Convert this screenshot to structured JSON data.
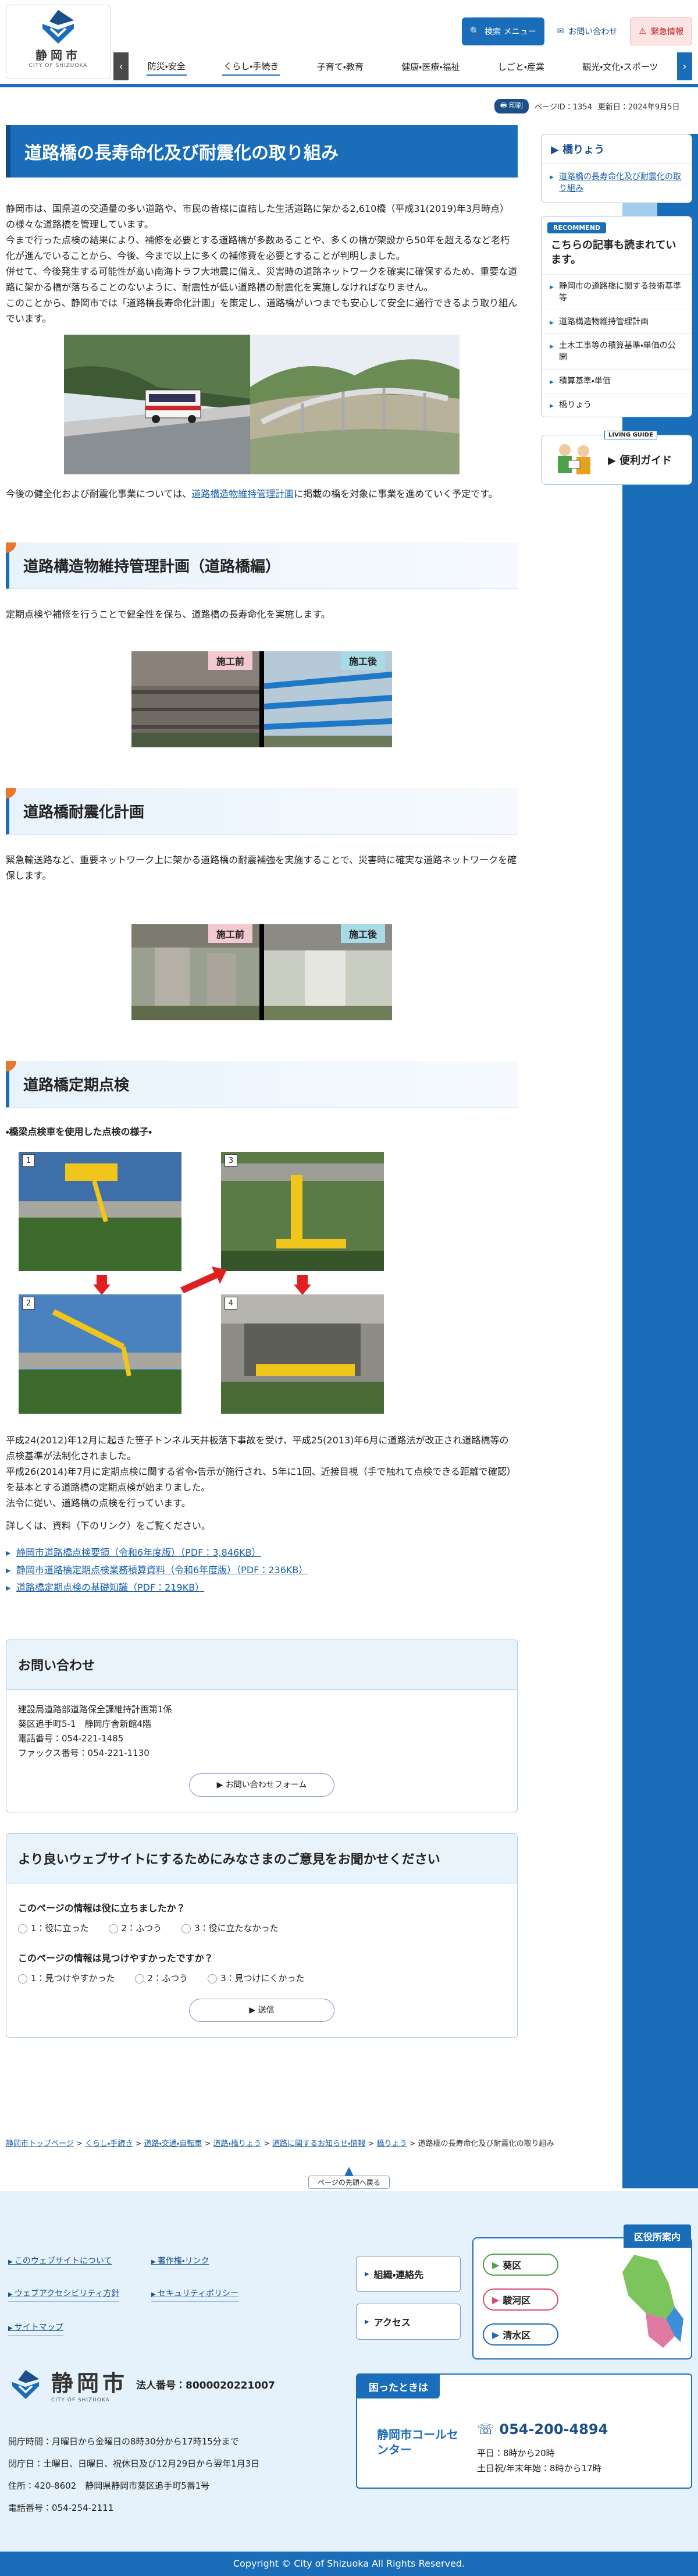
{
  "header": {
    "logo_name": "静岡市",
    "logo_sub": "CITY OF SHIZUOKA",
    "tools": {
      "search": "検索 メニュー",
      "contact": "お問い合わせ",
      "emergency": "緊急情報"
    },
    "nav": [
      "防災・安全",
      "くらし・手続き",
      "子育て・教育",
      "健康・医療・福祉",
      "しごと・産業",
      "観光・文化・スポーツ"
    ]
  },
  "page_info": {
    "print": "印刷",
    "page_id": "ページID：1354",
    "updated": "更新日：2024年9月5日"
  },
  "main": {
    "title": "道路橋の長寿命化及び耐震化の取り組み",
    "intro": [
      "静岡市は、国県道の交通量の多い道路や、市民の皆様に直結した生活道路に架かる2,610橋（平成31(2019)年3月時点）の様々な道路橋を管理しています。",
      "今まで行った点検の結果により、補修を必要とする道路橋が多数あることや、多くの橋が架設から50年を超えるなど老朽化が進んでいることから、今後、今まで以上に多くの補修費を必要とすることが判明しました。",
      "併せて、今後発生する可能性が高い南海トラフ大地震に備え、災害時の道路ネットワークを確実に確保するため、重要な道路に架かる橋が落ちることのないように、耐震性が低い道路橋の耐震化を実施しなければなりません。",
      "このことから、静岡市では「道路橋長寿命化計画」を策定し、道路橋がいつまでも安心して安全に通行できるよう取り組んでいます。"
    ],
    "plan_prefix": "今後の健全化および耐震化事業については、",
    "plan_link": "道路構造物維持管理計画",
    "plan_suffix": "に掲載の橋を対象に事業を進めていく予定です。",
    "section1": {
      "title": "道路構造物維持管理計画（道路橋編）",
      "text": "定期点検や補修を行うことで健全性を保ち、道路橋の長寿命化を実施します。",
      "before": "施工前",
      "after": "施工後"
    },
    "section2": {
      "title": "道路橋耐震化計画",
      "text": "緊急輸送路など、重要ネットワーク上に架かる道路橋の耐震補強を実施することで、災害時に確実な道路ネットワークを確保します。",
      "before": "施工前",
      "after": "施工後"
    },
    "section3": {
      "title": "道路橋定期点検",
      "step_label": "・橋梁点検車を使用した点検の様子・",
      "steps": [
        "1",
        "2",
        "3",
        "4"
      ],
      "texts": [
        "平成24(2012)年12月に起きた笹子トンネル天井板落下事故を受け、平成25(2013)年6月に道路法が改正され道路橋等の点検基準が法制化されました。",
        "平成26(2014)年7月に定期点検に関する省令・告示が施行され、5年に1回、近接目視（手で触れて点検できる距離で確認）を基本とする道路橋の定期点検が始まりました。",
        "法令に従い、道路橋の点検を行っています。"
      ],
      "see_more": "詳しくは、資料（下のリンク）をご覧ください。",
      "links": [
        "静岡市道路橋点検要領（令和6年度版）（PDF：3,846KB）",
        "静岡市道路橋定期点検業務積算資料（令和6年度版）（PDF：236KB）",
        "道路橋定期点検の基礎知識（PDF：219KB）"
      ]
    },
    "contact": {
      "title": "お問い合わせ",
      "lines": [
        "建設局道路部道路保全課維持計画第1係",
        "葵区追手町5-1　静岡庁舎新館4階",
        "電話番号：054-221-1485",
        "ファックス番号：054-221-1130"
      ],
      "button": "お問い合わせフォーム"
    },
    "survey": {
      "title": "より良いウェブサイトにするためにみなさまのご意見をお聞かせください",
      "q1": "このページの情報は役に立ちましたか？",
      "q1_opts": [
        "1：役に立った",
        "2：ふつう",
        "3：役に立たなかった"
      ],
      "q2": "このページの情報は見つけやすかったですか？",
      "q2_opts": [
        "1：見つけやすかった",
        "2：ふつう",
        "3：見つけにくかった"
      ],
      "submit": "送信"
    }
  },
  "breadcrumb": [
    "静岡市トップページ",
    "くらし・手続き",
    "道路・交通・自転車",
    "道路・橋りょう",
    "道路に関するお知らせ・情報",
    "橋りょう",
    "道路橋の長寿命化及び耐震化の取り組み"
  ],
  "sidebar": {
    "category": "橋りょう",
    "current": "道路橋の長寿命化及び耐震化の取り組み",
    "reco_badge": "RECOMMEND",
    "reco_title": "こちらの記事も読まれています。",
    "reco_items": [
      "静岡市の道路橋に関する技術基準等",
      "道路構造物維持管理計画",
      "土木工事等の積算基準・単価の公開",
      "積算基準・単価",
      "橋りょう"
    ],
    "living_label": "LIVING GUIDE",
    "living_text": "便利ガイド"
  },
  "totop": "ページの先頭へ戻る",
  "footer": {
    "links": [
      "このウェブサイトについて",
      "著作権・リンク",
      "ウェブアクセシビリティ方針",
      "セキュリティポリシー",
      "サイトマップ"
    ],
    "btn_org": "組織・連絡先",
    "btn_access": "アクセス",
    "ward_title": "区役所案内",
    "wards": [
      "葵区",
      "駿河区",
      "清水区"
    ],
    "corp": "法人番号：8000020221007",
    "info": [
      "開庁時間：月曜日から金曜日の8時30分から17時15分まで",
      "閉庁日：土曜日、日曜日、祝休日及び12月29日から翌年1月3日",
      "住所：420-8602　静岡県静岡市葵区追手町5番1号",
      "電話番号：054-254-2111"
    ],
    "trouble": "困ったときは",
    "center": "静岡市コールセンター",
    "phone": "054-200-4894",
    "hours": [
      "平日：8時から20時",
      "土日祝/年末年始：8時から17時"
    ]
  },
  "copyright": "Copyright © City of Shizuoka All Rights Reserved.",
  "colors": {
    "primary": "#1a6db8",
    "accent": "#e8782a",
    "emergency": "#c21f1f"
  }
}
